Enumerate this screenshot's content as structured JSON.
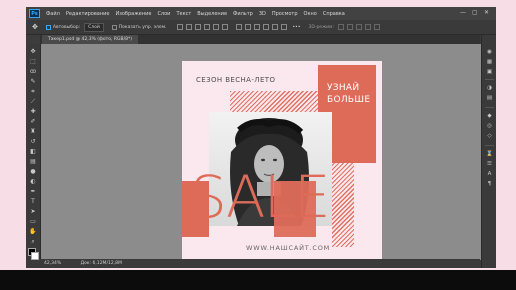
{
  "app": {
    "logo_text": "Ps",
    "menu": [
      "Файл",
      "Редактирование",
      "Изображение",
      "Слои",
      "Текст",
      "Выделение",
      "Фильтр",
      "3D",
      "Просмотр",
      "Окно",
      "Справка"
    ],
    "window_controls": {
      "minimize": "—",
      "maximize": "▢",
      "close": "✕"
    }
  },
  "options_bar": {
    "auto_select_label": "Автовыбор:",
    "auto_select_value": "Слой",
    "show_controls_label": "Показать упр. элем.",
    "mode_3d_label": "3D-режим:"
  },
  "document": {
    "tab_title": "Такер1.psd @ 42,3% (фото, RGB/8*)"
  },
  "design": {
    "season_text": "СЕЗОН ВЕСНА-ЛЕТО",
    "cta_line1": "УЗНАЙ",
    "cta_line2": "БОЛЬШЕ",
    "sale_text": "SALE",
    "website_text": "WWW.НАШСАЙТ.COM",
    "accent_color": "#de6b58",
    "background_color": "#fbe8ee"
  },
  "status_bar": {
    "zoom": "42,34%",
    "doc_info": "Док: 6,12М/12,8М"
  },
  "tools": [
    "move-icon",
    "marquee-icon",
    "lasso-icon",
    "quick-select-icon",
    "crop-icon",
    "eyedropper-icon",
    "healing-icon",
    "brush-icon",
    "stamp-icon",
    "history-brush-icon",
    "eraser-icon",
    "gradient-icon",
    "blur-icon",
    "dodge-icon",
    "pen-icon",
    "type-icon",
    "path-select-icon",
    "shape-icon",
    "hand-icon",
    "zoom-icon",
    "more-icon"
  ],
  "swatches": {
    "foreground": "#000000",
    "background": "#ffffff"
  }
}
